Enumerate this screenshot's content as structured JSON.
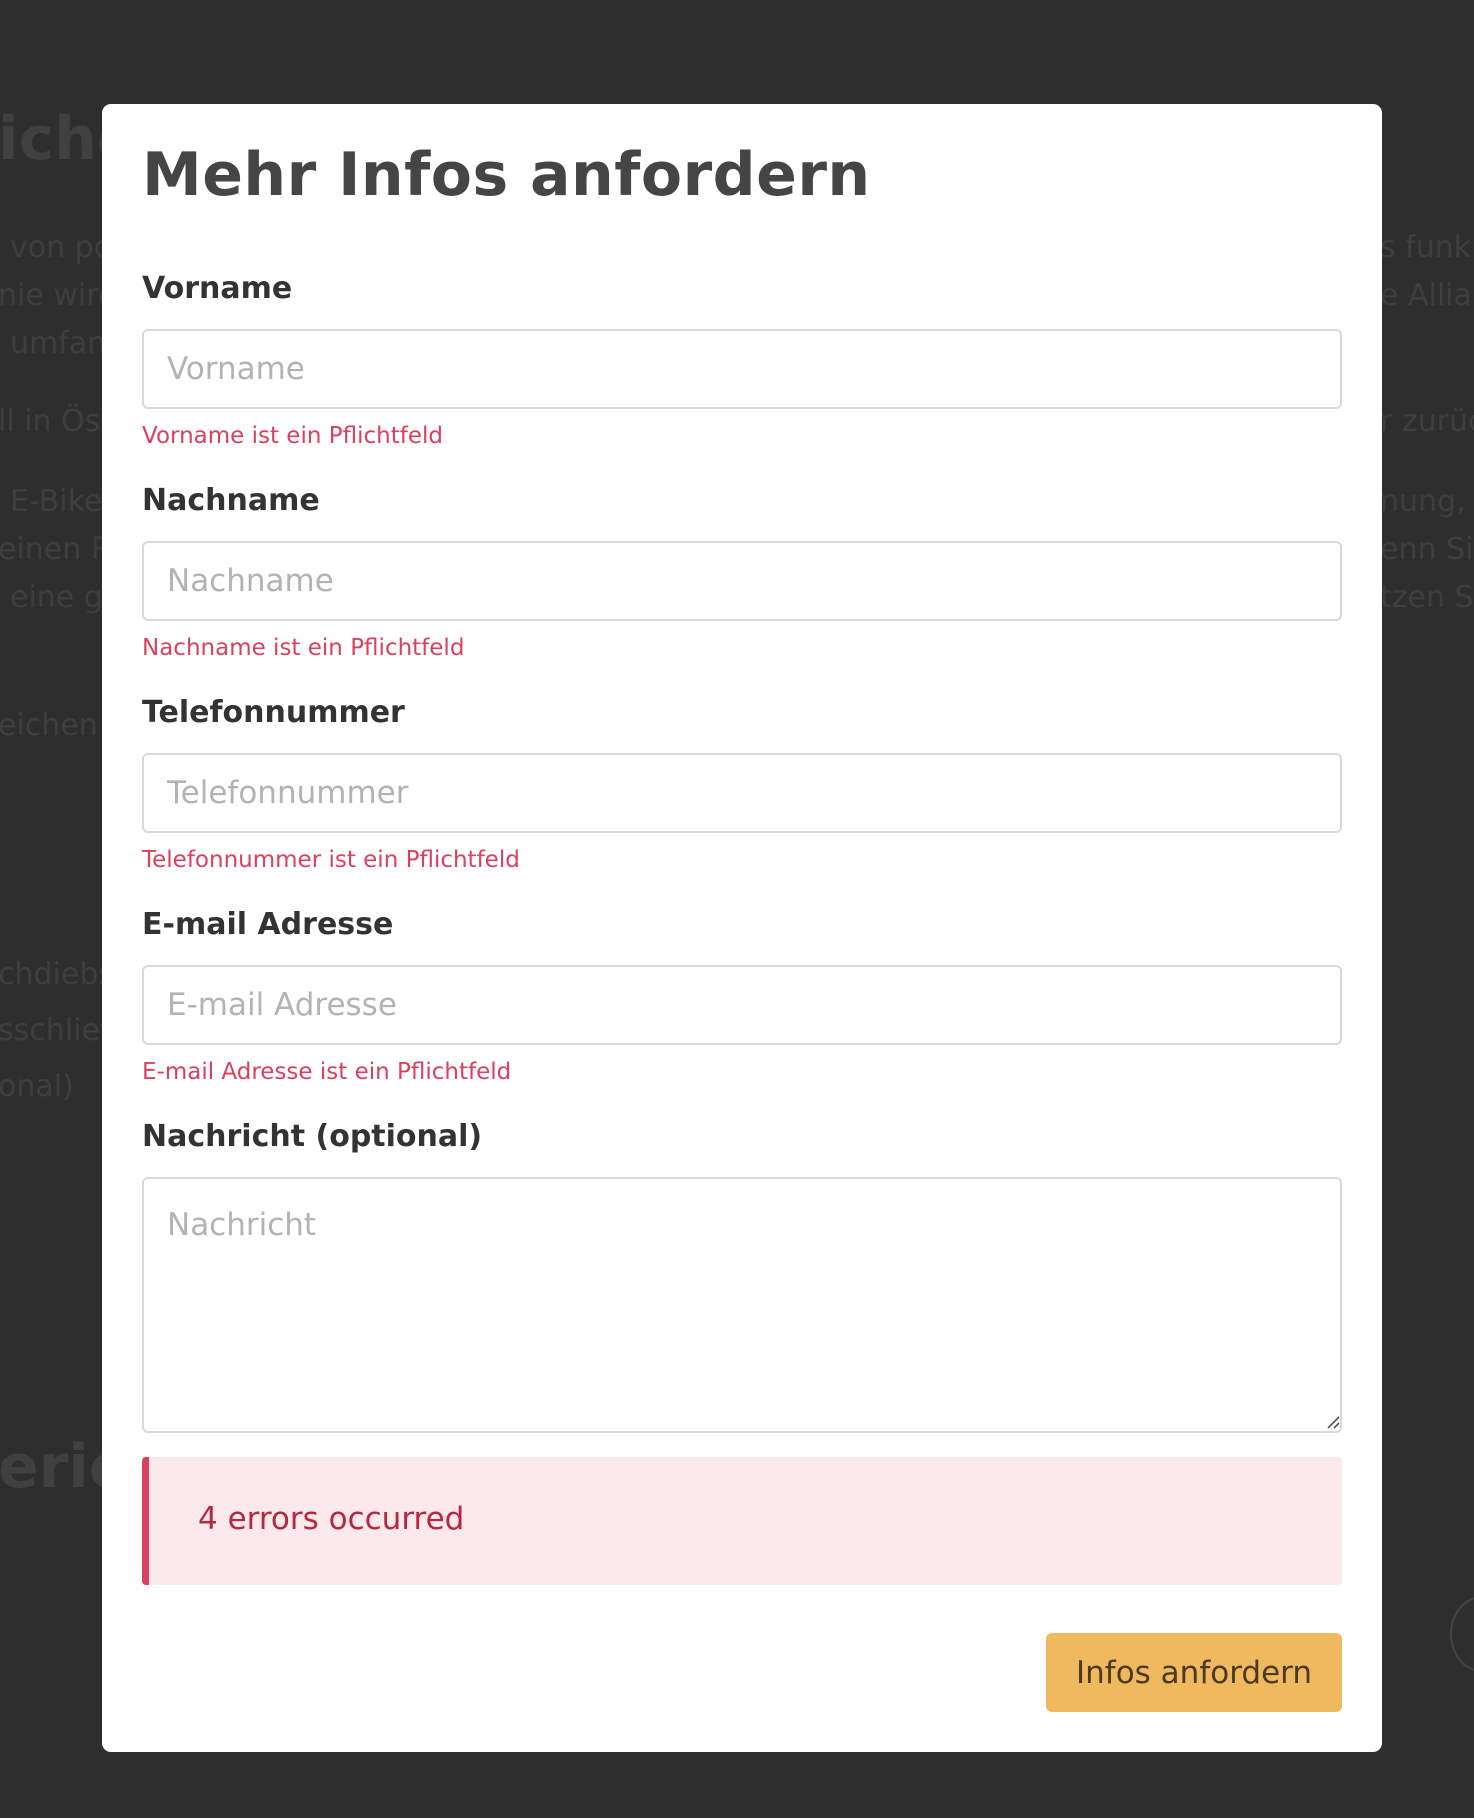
{
  "background": {
    "fragments": [
      "iche",
      "von po",
      "nie wird",
      "umfan",
      "ll in Ös",
      "E-Bike",
      "einen R",
      "eine ge",
      "eichen S",
      "chdiebs",
      "sschlief",
      "onal)",
      "erie",
      "s funk",
      "e Allian",
      "r zurüc",
      "nung, e",
      "enn Si",
      "tzen S"
    ]
  },
  "modal": {
    "title": "Mehr Infos anfordern",
    "fields": {
      "vorname": {
        "label": "Vorname",
        "placeholder": "Vorname",
        "value": "",
        "error": "Vorname ist ein Pflichtfeld"
      },
      "nachname": {
        "label": "Nachname",
        "placeholder": "Nachname",
        "value": "",
        "error": "Nachname ist ein Pflichtfeld"
      },
      "telefon": {
        "label": "Telefonnummer",
        "placeholder": "Telefonnummer",
        "value": "",
        "error": "Telefonnummer ist ein Pflichtfeld"
      },
      "email": {
        "label": "E-mail Adresse",
        "placeholder": "E-mail Adresse",
        "value": "",
        "error": "E-mail Adresse ist ein Pflichtfeld"
      },
      "nachricht": {
        "label": "Nachricht (optional)",
        "placeholder": "Nachricht",
        "value": ""
      }
    },
    "alert": {
      "text": "4 errors occurred"
    },
    "submit_label": "Infos anfordern"
  },
  "colors": {
    "overlay": "#2e2e2e",
    "error": "#d9415e",
    "alert_background": "#fbe9ec",
    "button": "#f0b95f"
  }
}
